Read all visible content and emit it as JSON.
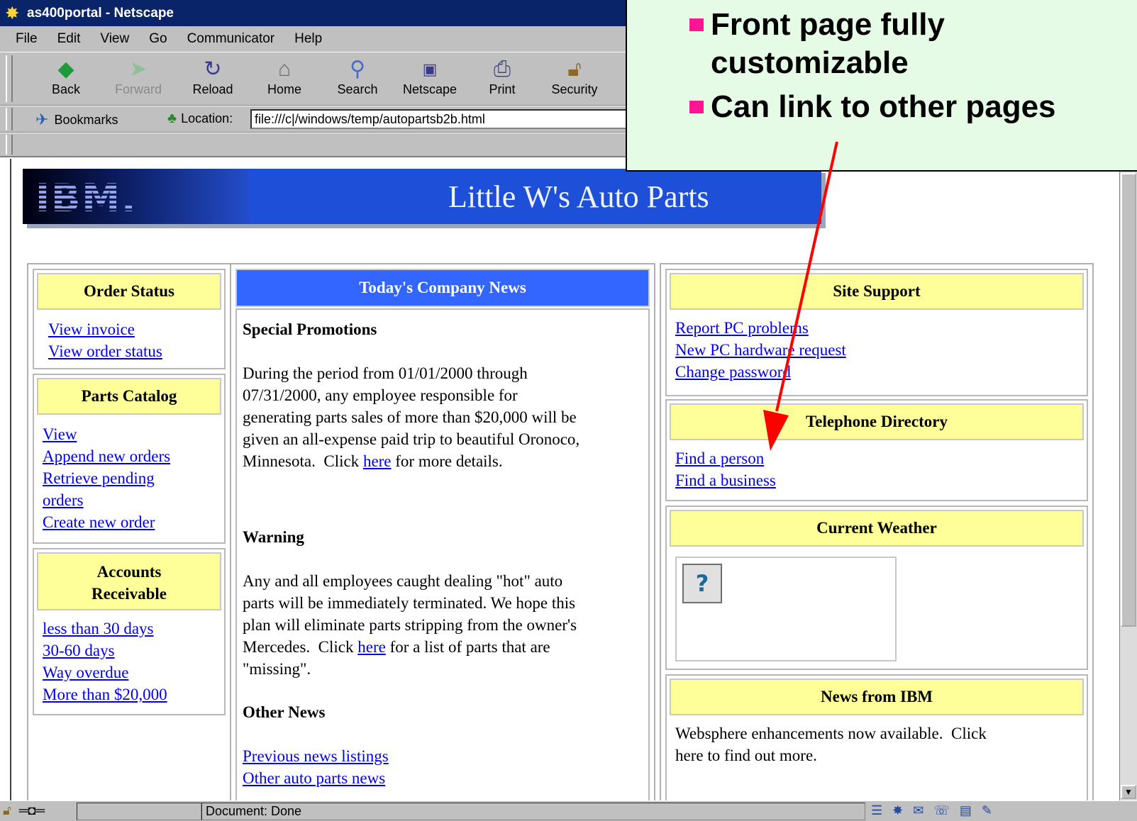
{
  "window": {
    "title": "as400portal - Netscape",
    "icon": "netscape-star-icon"
  },
  "menubar": [
    "File",
    "Edit",
    "View",
    "Go",
    "Communicator",
    "Help"
  ],
  "toolbar": {
    "buttons": [
      {
        "label": "Back",
        "icon": "back-arrow-icon",
        "enabled": true
      },
      {
        "label": "Forward",
        "icon": "forward-arrow-icon",
        "enabled": false
      },
      {
        "label": "Reload",
        "icon": "reload-icon",
        "enabled": true
      },
      {
        "label": "Home",
        "icon": "home-icon",
        "enabled": true
      },
      {
        "label": "Search",
        "icon": "search-icon",
        "enabled": true
      },
      {
        "label": "Netscape",
        "icon": "my-netscape-icon",
        "enabled": true
      },
      {
        "label": "Print",
        "icon": "print-icon",
        "enabled": true
      },
      {
        "label": "Security",
        "icon": "security-lock-icon",
        "enabled": true
      }
    ]
  },
  "locationbar": {
    "bookmarks_label": "Bookmarks",
    "location_label": "Location:",
    "url": "file:///c|/windows/temp/autopartsb2b.html"
  },
  "banner": {
    "logo_text": "IBM.",
    "title": "Little W's Auto Parts"
  },
  "left": {
    "order_status": {
      "header": "Order Status",
      "links": [
        "View invoice",
        "View order status"
      ]
    },
    "parts_catalog": {
      "header": "Parts Catalog",
      "links": [
        "View",
        "Append new orders",
        "Retrieve pending",
        "orders ",
        "Create new order"
      ]
    },
    "accounts_receivable": {
      "header_line1": "Accounts",
      "header_line2": "Receivable",
      "links": [
        "less than 30 days",
        "30-60 days",
        "Way overdue",
        "More than $20,000"
      ]
    }
  },
  "center": {
    "header": "Today's Company News",
    "promotions": {
      "heading": "Special Promotions",
      "lines": [
        "During the period from 01/01/2000 through",
        "07/31/2000, any employee responsible for",
        "generating parts sales of more than $20,000 will be",
        "given an all-expense paid trip to beautiful Oronoco,"
      ],
      "last_prefix": "Minnesota.  Click ",
      "link": "here",
      "last_suffix": " for more details."
    },
    "warning": {
      "heading": "Warning",
      "lines": [
        "Any and all employees caught dealing \"hot\" auto",
        "parts will be immediately terminated.  We hope this",
        "plan will eliminate parts stripping from the owner's"
      ],
      "line4_prefix": "Mercedes.  Click ",
      "link": "here",
      "line4_suffix": " for a list of parts that are",
      "line5": "\"missing\"."
    },
    "other_news": {
      "heading": "Other News",
      "links": [
        "Previous news listings",
        "Other auto parts news"
      ]
    }
  },
  "right": {
    "site_support": {
      "header": "Site Support",
      "links": [
        "Report PC problems",
        "New PC hardware request",
        "Change password"
      ]
    },
    "telephone": {
      "header": "Telephone Directory",
      "links": [
        "Find a person",
        "Find a business"
      ]
    },
    "weather": {
      "header": "Current Weather",
      "image_icon": "broken-image-icon"
    },
    "ibm_news": {
      "header": "News from IBM",
      "lines": [
        "Websphere enhancements now available.  Click",
        "here to find out more."
      ]
    }
  },
  "statusbar": {
    "text": "Document: Done"
  },
  "callout": {
    "bullets": [
      {
        "line1": "Front page fully",
        "line2": "customizable"
      },
      {
        "line1": "Can link to other pages",
        "line2": ""
      }
    ],
    "bullet_color": "#ff1493",
    "arrow_color": "#ff0000",
    "background": "#e6fbe6"
  },
  "colors": {
    "link": "#0000ee",
    "header_yellow": "#ffff99",
    "header_blue": "#3366ff",
    "banner_blue": "#1d4fd8"
  }
}
